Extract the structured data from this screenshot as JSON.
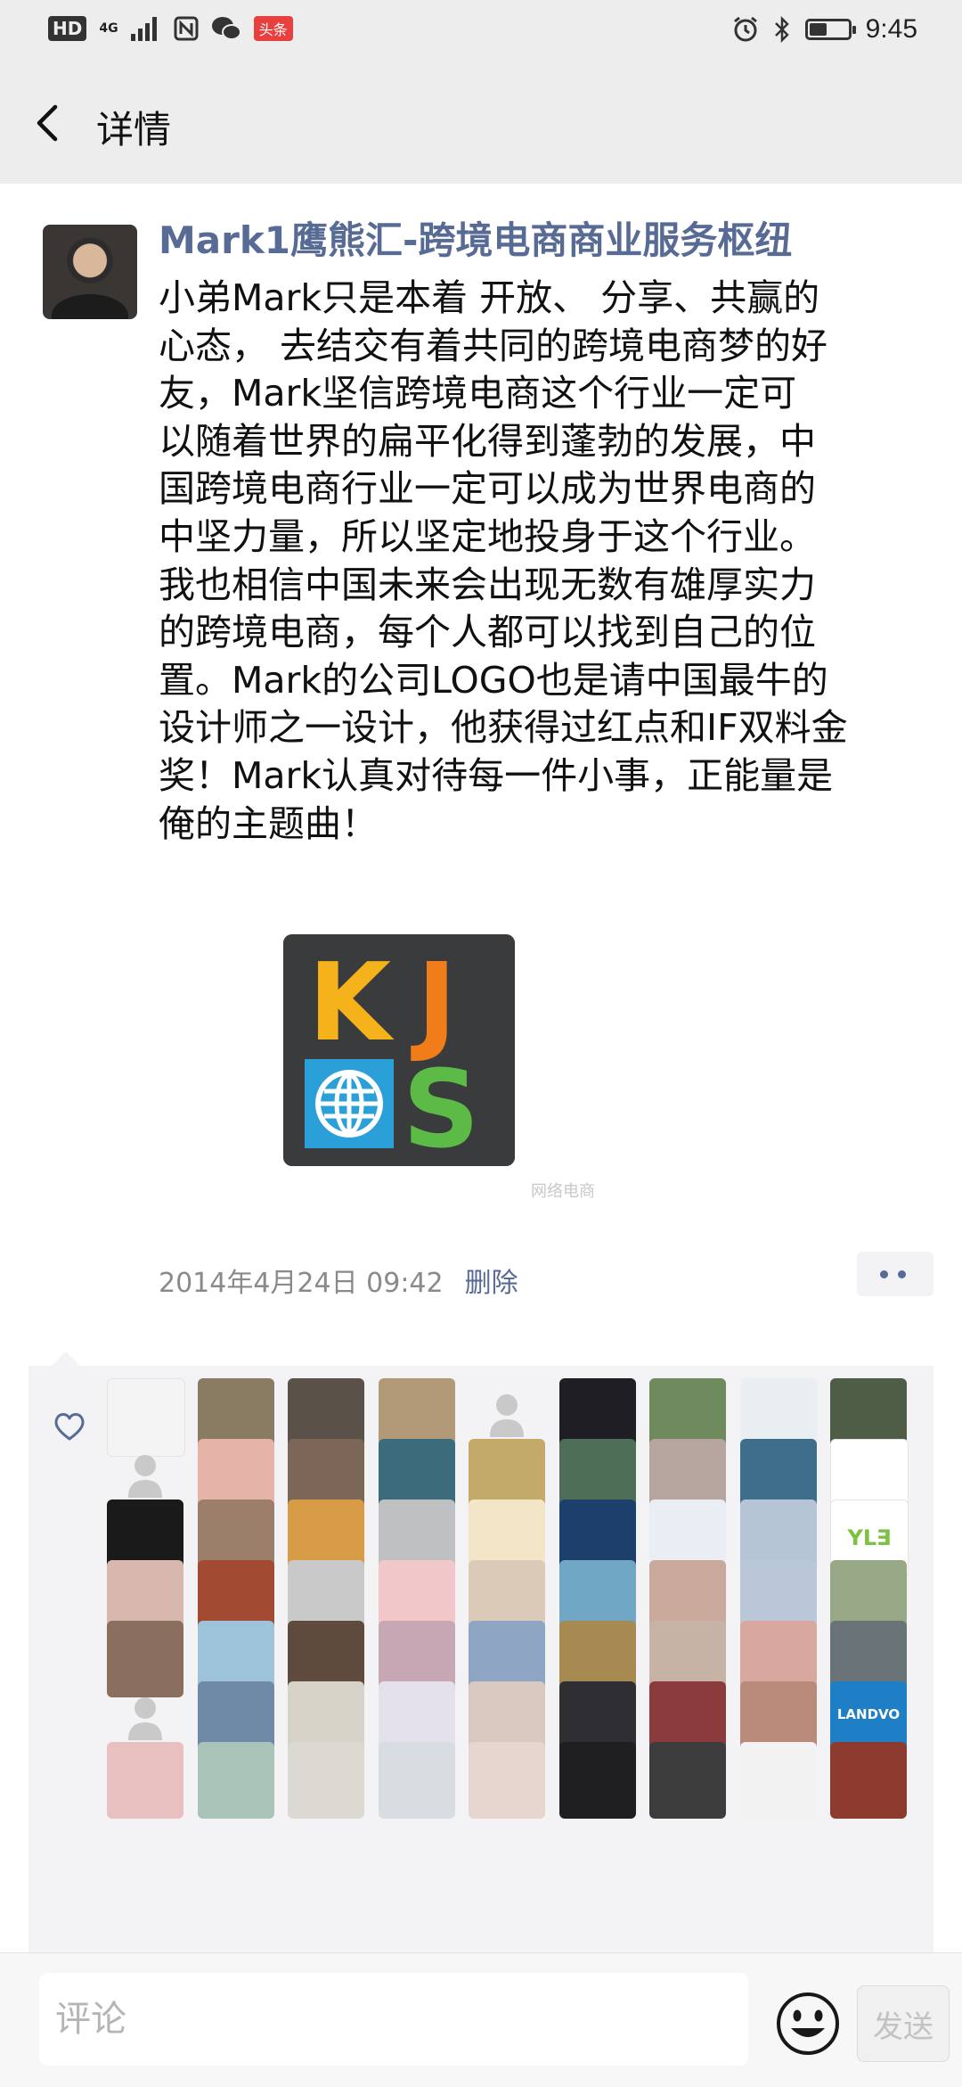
{
  "status_bar": {
    "hd": "HD",
    "network": "4G",
    "app_badge": "头条",
    "time": "9:45",
    "battery_level": 0.45,
    "icons": [
      "nfc-icon",
      "wechat-icon",
      "alarm-icon",
      "bluetooth-icon",
      "battery-icon"
    ]
  },
  "nav": {
    "title": "详情",
    "back_icon": "chevron-left-icon"
  },
  "post": {
    "author": "Mark1鹰熊汇-跨境电商商业服务枢纽",
    "text_lines": [
      "小弟Mark只是本着 开放、 分享、共赢的",
      "心态， 去结交有着共同的跨境电商梦的好",
      "友，Mark坚信跨境电商这个行业一定可",
      "以随着世界的扁平化得到蓬勃的发展，中",
      "国跨境电商行业一定可以成为世界电商的",
      "中坚力量，所以坚定地投身于这个行业。",
      "我也相信中国未来会出现无数有雄厚实力",
      "的跨境电商，每个人都可以找到自己的位",
      "置。Mark的公司LOGO也是请中国最牛的",
      "设计师之一设计，他获得过红点和IF双料金",
      "奖！Mark认真对待每一件小事，正能量是",
      "俺的主题曲！"
    ],
    "image": {
      "letters": [
        "K",
        "J",
        "S"
      ],
      "colors": {
        "k": "#f5b21a",
        "j": "#f07d1a",
        "globe": "#2a9fd8",
        "s": "#5cbb46",
        "bg": "#3a3b3c"
      },
      "watermark": "网络电商"
    },
    "timestamp": "2014年4月24日 09:42",
    "delete_label": "删除",
    "more_icon": "more-dots-icon"
  },
  "likes": {
    "icon": "heart-icon",
    "avatars": [
      [
        "#f4f4f4",
        "#8a7c63",
        "#5a5148",
        "#b29a78",
        "placeholder",
        "#1e1e24",
        "#6f8a5c",
        "#e9eef2",
        "#4f5d47"
      ],
      [
        "placeholder",
        "#e6b3a8",
        "#7b6658",
        "#3c6b7c",
        "#c3a96a",
        "#4f6e58",
        "#b7a6a0",
        "#3f6e8a",
        "#ffffff"
      ],
      [
        "#1a1a1a",
        "#9c7f6b",
        "#d89c47",
        "#bfc0c2",
        "#f3e6c8",
        "#1d3f6b",
        "#e8eef4",
        "#b6c5d6",
        "#ffffff"
      ],
      [
        "#d8b8ae",
        "#a24a32",
        "#c9c9c9",
        "#f2c7c9",
        "#dccab8",
        "#6fa7c4",
        "#c9a99b",
        "#b9c7d8",
        "#98a886"
      ],
      [
        "#8a6f5e",
        "#9cc3d8",
        "#5e4b3e",
        "#c7a7b3",
        "#8ea6c4",
        "#a68a52",
        "#c6b3a6",
        "#d8a8a0",
        "#6a7378"
      ],
      [
        "placeholder",
        "#6f8aa6",
        "#d8d3c8",
        "#e4e1ec",
        "#d8c8c0",
        "#2f2f33",
        "#8b3b3c",
        "#b98a7a",
        "#1f7fc6"
      ],
      [
        "#e8c0c0",
        "#a9c3b8",
        "#dcd9d2",
        "#d8dde2",
        "#e6d6cf",
        "#1f1f22",
        "#3c3c3c",
        "#f2f2f2",
        "#8d3a2f"
      ]
    ],
    "avatar_texts": {
      "2.8": "YL∃",
      "5.8": "LANDVO"
    }
  },
  "bottom_bar": {
    "placeholder": "评论",
    "emoji_icon": "emoji-icon",
    "send_label": "发送"
  }
}
